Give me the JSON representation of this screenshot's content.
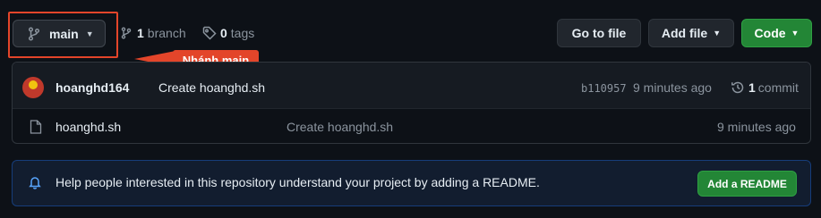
{
  "branch_selector": {
    "label": "main"
  },
  "annotation": {
    "callout": "Nhánh main"
  },
  "meta": {
    "branch_count": "1",
    "branch_label": "branch",
    "tag_count": "0",
    "tag_label": "tags"
  },
  "toolbar": {
    "go_to_file": "Go to file",
    "add_file": "Add file",
    "code": "Code"
  },
  "latest_commit": {
    "author": "hoanghd164",
    "message": "Create hoanghd.sh",
    "sha": "b110957",
    "time": "9 minutes ago",
    "commit_count": "1",
    "commit_label": "commit"
  },
  "files": [
    {
      "name": "hoanghd.sh",
      "message": "Create hoanghd.sh",
      "time": "9 minutes ago"
    }
  ],
  "readme_banner": {
    "text": "Help people interested in this repository understand your project by adding a README.",
    "button": "Add a README"
  },
  "colors": {
    "accent_green": "#238636",
    "annotation_red": "#e3452a",
    "background": "#0d1117"
  },
  "icons": [
    "git-branch-icon",
    "tag-icon",
    "history-icon",
    "file-icon",
    "bell-icon",
    "caret-down-icon"
  ]
}
